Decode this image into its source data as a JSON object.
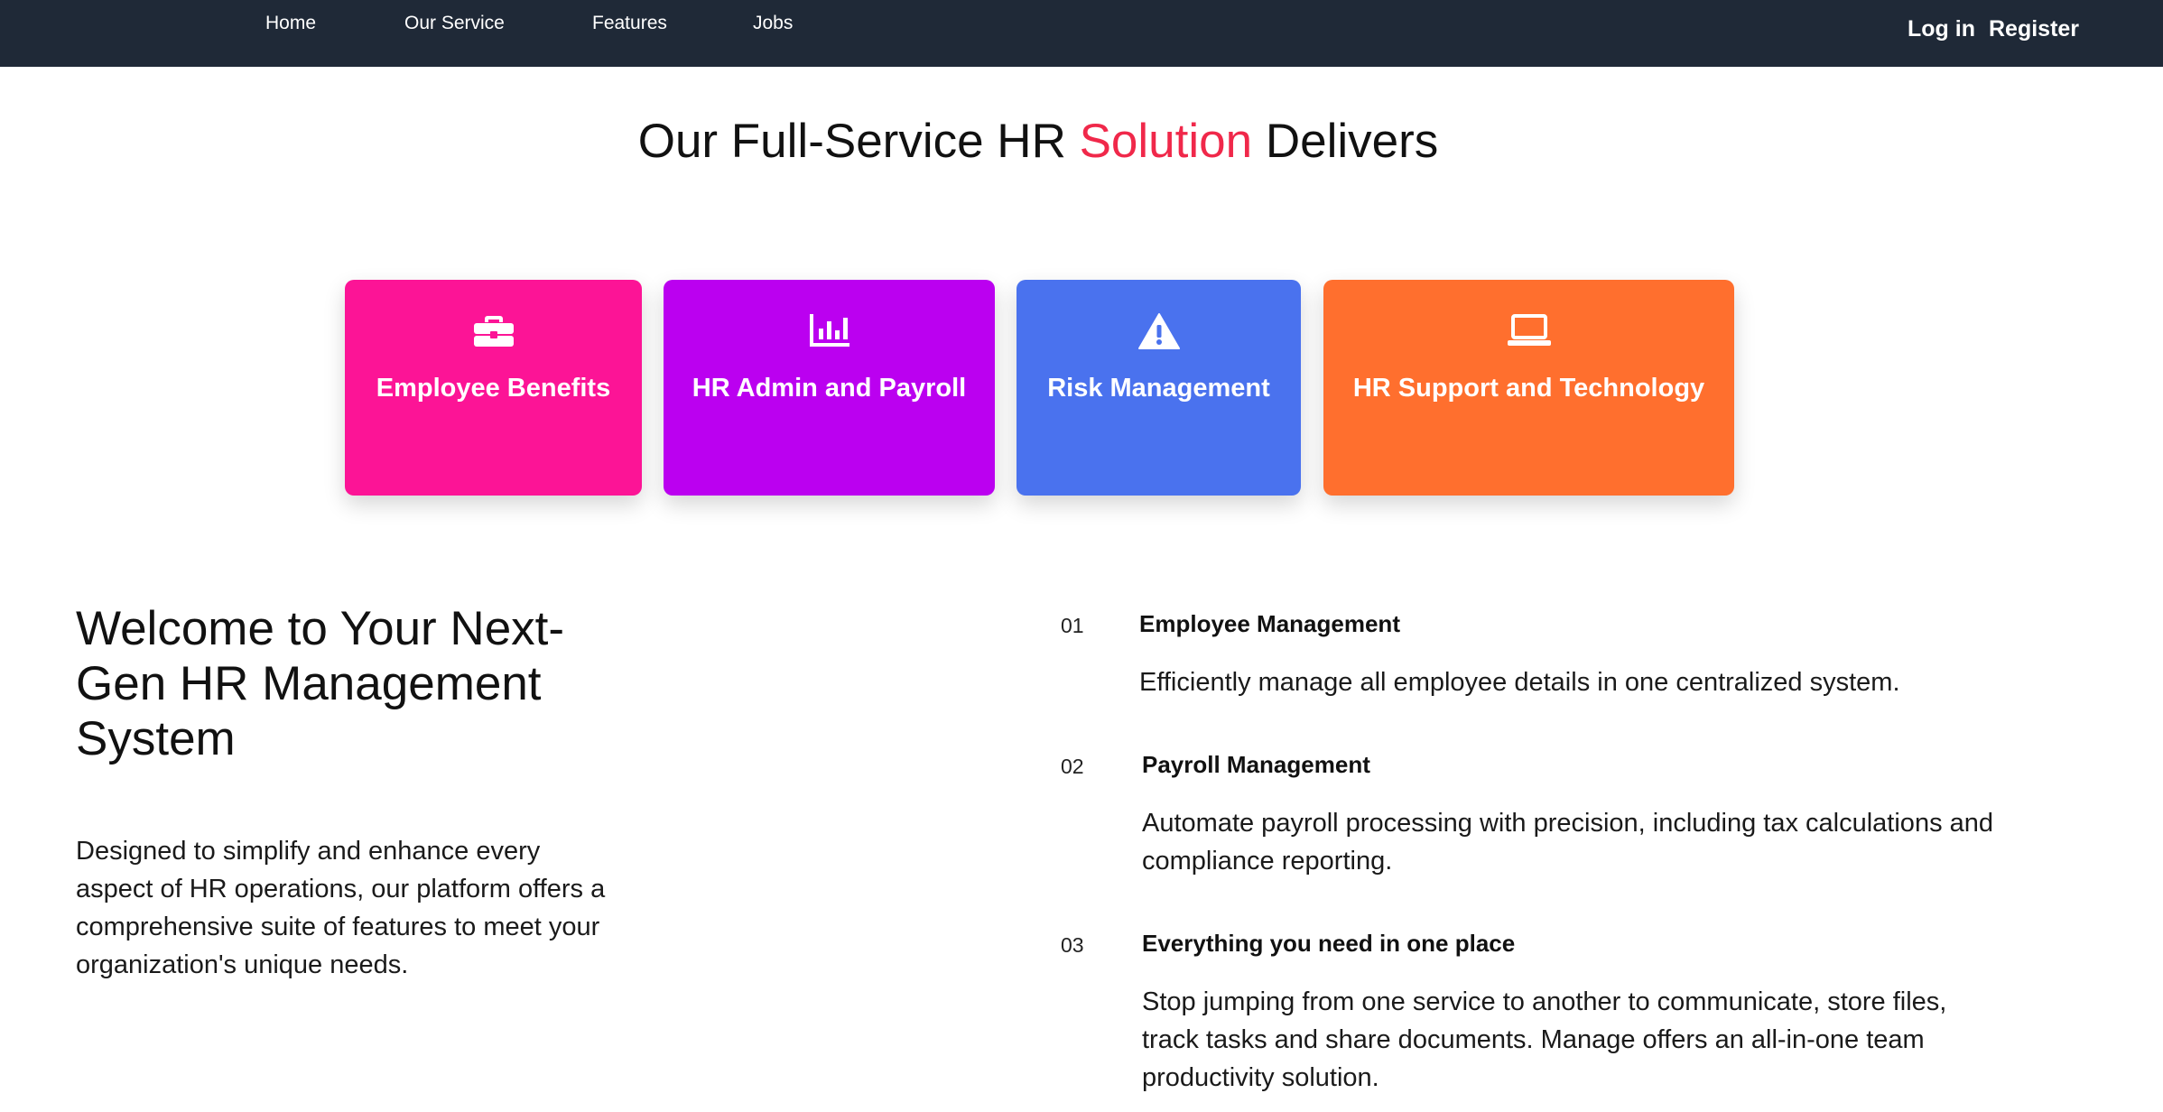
{
  "nav": {
    "links": [
      "Home",
      "Our Service",
      "Features",
      "Jobs"
    ],
    "login_label": "Log in",
    "register_label": "Register"
  },
  "hero": {
    "title_pre": "Our Full-Service HR ",
    "title_accent": "Solution",
    "title_post": " Delivers"
  },
  "cards": [
    {
      "label": "Employee Benefits",
      "icon": "briefcase-icon",
      "color": "#fc1496"
    },
    {
      "label": "HR Admin and Payroll",
      "icon": "bar-chart-icon",
      "color": "#bb00f0"
    },
    {
      "label": "Risk Management",
      "icon": "warning-icon",
      "color": "#4a72ee"
    },
    {
      "label": "HR Support and Technology",
      "icon": "laptop-icon",
      "color": "#ff6f2e"
    }
  ],
  "welcome": {
    "title": "Welcome to Your Next-Gen HR Management System",
    "description": "Designed to simplify and enhance every aspect of HR operations, our platform offers a comprehensive suite of features to meet your organization's unique needs."
  },
  "features": [
    {
      "number": "01",
      "title": "Employee Management",
      "description": "Efficiently manage all employee details in one centralized system."
    },
    {
      "number": "02",
      "title": "Payroll Management",
      "description": "Automate payroll processing with precision, including tax calculations and compliance reporting."
    },
    {
      "number": "03",
      "title": "Everything you need in one place",
      "description": "Stop jumping from one service to another to communicate, store files, track tasks and share documents. Manage offers an all-in-one team productivity solution."
    }
  ],
  "colors": {
    "nav_bg": "#1f2937",
    "accent": "#f0284a"
  }
}
